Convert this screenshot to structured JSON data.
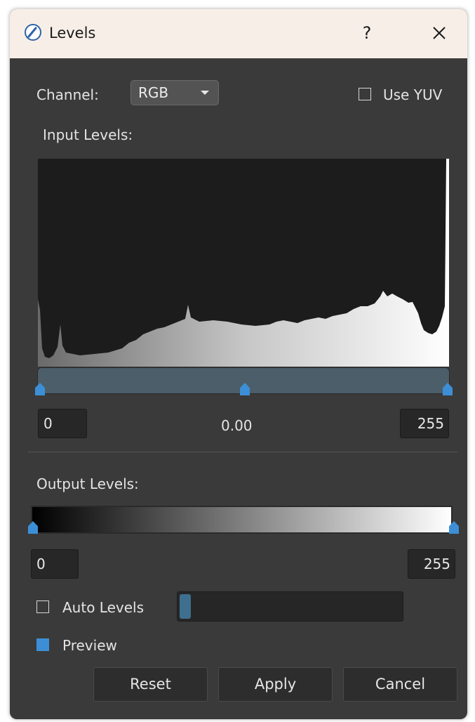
{
  "window": {
    "title": "Levels",
    "help_label": "?"
  },
  "channel": {
    "label": "Channel:",
    "selected": "RGB"
  },
  "use_yuv": {
    "label": "Use YUV",
    "checked": false
  },
  "input_levels": {
    "label": "Input Levels:",
    "black_point": "0",
    "gamma": "0.00",
    "white_point": "255"
  },
  "output_levels": {
    "label": "Output Levels:",
    "min": "0",
    "max": "255"
  },
  "auto_levels": {
    "label": "Auto Levels",
    "checked": false
  },
  "preview": {
    "label": "Preview",
    "checked": true
  },
  "buttons": {
    "reset": "Reset",
    "apply": "Apply",
    "cancel": "Cancel"
  },
  "colors": {
    "accent": "#3c8fd6",
    "panel": "#3a3a3a",
    "titlebar": "#f7efe7",
    "track": "#4c5e69"
  }
}
